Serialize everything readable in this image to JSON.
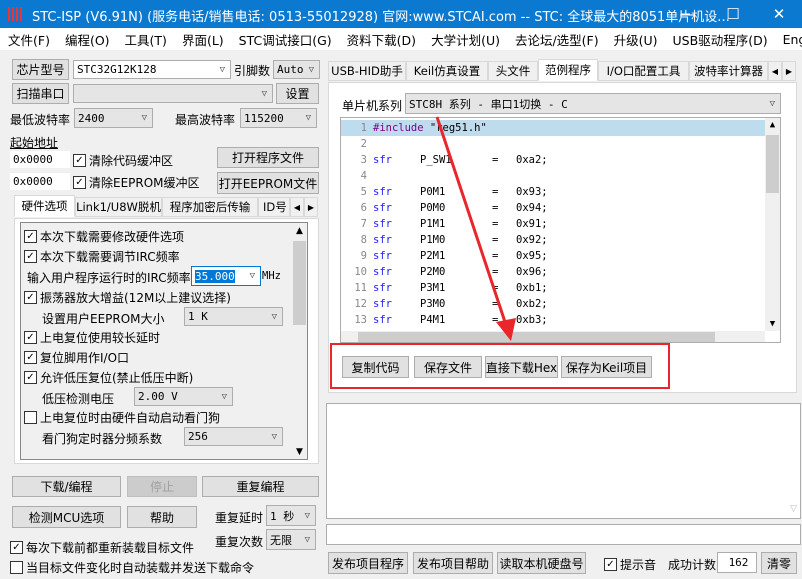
{
  "title": "STC-ISP (V6.91N) (服务电话/销售电话: 0513-55012928) 官网:www.STCAI.com  -- STC: 全球最大的8051单片机设...",
  "window_controls": {
    "minimize": "—",
    "maximize": "☐",
    "close": "✕"
  },
  "menu": [
    "文件(F)",
    "编程(O)",
    "工具(T)",
    "界面(L)",
    "STC调试接口(G)",
    "资料下载(D)",
    "大学计划(U)",
    "去论坛/选型(F)",
    "升级(U)",
    "USB驱动程序(D)",
    "English"
  ],
  "left": {
    "chip_btn": "芯片型号",
    "chip_value": "STC32G12K128",
    "pins_label": "引脚数",
    "pins_value": "Auto",
    "scan_btn": "扫描串口",
    "port_value": "",
    "settings_btn": "设置",
    "min_baud_label": "最低波特率",
    "min_baud": "2400",
    "max_baud_label": "最高波特率",
    "max_baud": "115200",
    "start_addr_label": "起始地址",
    "addr1": "0x0000",
    "clear_code": "清除代码缓冲区",
    "open_prog": "打开程序文件",
    "addr2": "0x0000",
    "clear_eeprom": "清除EEPROM缓冲区",
    "open_eeprom": "打开EEPROM文件",
    "tabs": [
      "硬件选项",
      "Link1/U8W脱机",
      "程序加密后传输",
      "ID号"
    ],
    "options": {
      "opt1": "本次下载需要修改硬件选项",
      "opt2": "本次下载需要调节IRC频率",
      "irc_label": "输入用户程序运行时的IRC频率",
      "irc_value": "35.000",
      "irc_unit": "MHz",
      "opt3": "振荡器放大增益(12M以上建议选择)",
      "eeprom_label": "设置用户EEPROM大小",
      "eeprom_value": "1    K",
      "opt4": "上电复位使用较长延时",
      "opt5": "复位脚用作I/O口",
      "opt6": "允许低压复位(禁止低压中断)",
      "lv_label": "低压检测电压",
      "lv_value": "2.00 V",
      "opt7": "上电复位时由硬件自动启动看门狗",
      "wdt_label": "看门狗定时器分频系数",
      "wdt_value": "256"
    },
    "download_btn": "下载/编程",
    "stop_btn": "停止",
    "repeat_btn": "重复编程",
    "detect_btn": "检测MCU选项",
    "help_btn": "帮助",
    "delay_label": "重复延时",
    "delay_value": "1 秒",
    "count_label": "重复次数",
    "count_value": "无限",
    "reload_cb": "每次下载前都重新装载目标文件",
    "auto_cb": "当目标文件变化时自动装载并发送下载命令"
  },
  "right": {
    "tabs": [
      "USB-HID助手",
      "Keil仿真设置",
      "头文件",
      "范例程序",
      "I/O口配置工具",
      "波特率计算器"
    ],
    "series_label": "单片机系列",
    "series_value": "STC8H 系列 - 串口1切换 - C",
    "code": [
      {
        "n": "1",
        "a": "#include",
        "b": " \"reg51.h\"",
        "c": "",
        "d": ""
      },
      {
        "n": "2",
        "a": "",
        "b": "",
        "c": "",
        "d": ""
      },
      {
        "n": "3",
        "a": "sfr",
        "b": "P_SW1",
        "c": "=",
        "d": "0xa2;"
      },
      {
        "n": "4",
        "a": "",
        "b": "",
        "c": "",
        "d": ""
      },
      {
        "n": "5",
        "a": "sfr",
        "b": "P0M1",
        "c": "=",
        "d": "0x93;"
      },
      {
        "n": "6",
        "a": "sfr",
        "b": "P0M0",
        "c": "=",
        "d": "0x94;"
      },
      {
        "n": "7",
        "a": "sfr",
        "b": "P1M1",
        "c": "=",
        "d": "0x91;"
      },
      {
        "n": "8",
        "a": "sfr",
        "b": "P1M0",
        "c": "=",
        "d": "0x92;"
      },
      {
        "n": "9",
        "a": "sfr",
        "b": "P2M1",
        "c": "=",
        "d": "0x95;"
      },
      {
        "n": "10",
        "a": "sfr",
        "b": "P2M0",
        "c": "=",
        "d": "0x96;"
      },
      {
        "n": "11",
        "a": "sfr",
        "b": "P3M1",
        "c": "=",
        "d": "0xb1;"
      },
      {
        "n": "12",
        "a": "sfr",
        "b": "P3M0",
        "c": "=",
        "d": "0xb2;"
      },
      {
        "n": "13",
        "a": "sfr",
        "b": "P4M1",
        "c": "=",
        "d": "0xb3;"
      }
    ],
    "copy_btn": "复制代码",
    "save_btn": "保存文件",
    "download_hex_btn": "直接下载Hex",
    "save_keil_btn": "保存为Keil项目",
    "publish_btn": "发布项目程序",
    "publish_help_btn": "发布项目帮助",
    "read_disk_btn": "读取本机硬盘号",
    "sound_cb": "提示音",
    "success_label": "成功计数",
    "success_count": "162",
    "clear_btn": "清零"
  },
  "colors": {
    "title": "#0b79d0",
    "highlight": "#e8262b",
    "keyword": "#1a1aff",
    "preproc": "#80008a"
  }
}
